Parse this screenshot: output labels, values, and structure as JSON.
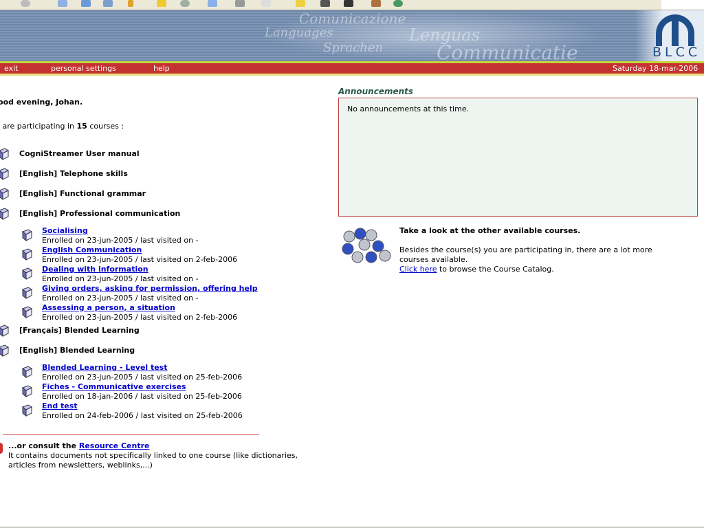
{
  "banner": {
    "watermarks": [
      "Comunicazione",
      "Lenguas",
      "Languages",
      "Sprachen",
      "Communicatie"
    ],
    "logo": "BLCC"
  },
  "nav": {
    "exit": "exit",
    "settings": "personal settings",
    "help": "help",
    "date": "Saturday 18-mar-2006"
  },
  "greeting": "Good evening, Johan.",
  "participating": {
    "pre": "You are participating in ",
    "count": "15",
    "post": " courses :"
  },
  "courses": [
    {
      "title": "CogniStreamer User manual"
    },
    {
      "title": "[English] Telephone skills"
    },
    {
      "title": "[English] Functional grammar"
    },
    {
      "title": "[English] Professional communication",
      "modules": [
        {
          "title": "Socialising",
          "info": "Enrolled on 23-jun-2005 / last visited on -"
        },
        {
          "title": "English Communication",
          "info": "Enrolled on 23-jun-2005 / last visited on 2-feb-2006"
        },
        {
          "title": "Dealing with information",
          "info": "Enrolled on 23-jun-2005 / last visited on -"
        },
        {
          "title": "Giving orders, asking for permission, offering help",
          "info": "Enrolled on 23-jun-2005 / last visited on -"
        },
        {
          "title": "Assessing a person, a situation",
          "info": "Enrolled on 23-jun-2005 / last visited on 2-feb-2006"
        }
      ]
    },
    {
      "title": "[Français] Blended Learning"
    },
    {
      "title": "[English] Blended Learning",
      "modules": [
        {
          "title": "Blended Learning - Level test",
          "info": "Enrolled on 23-jun-2005 / last visited on 25-feb-2006"
        },
        {
          "title": "Fiches - Communicative exercises",
          "info": "Enrolled on 18-jan-2006 / last visited on 25-feb-2006"
        },
        {
          "title": "End test",
          "info": "Enrolled on 24-feb-2006 / last visited on 25-feb-2006"
        }
      ]
    }
  ],
  "resource": {
    "pre": "...or consult the ",
    "link": "Resource Centre",
    "desc1": "It contains documents not specifically linked to one course (like dictionaries,",
    "desc2": "articles from newsletters, weblinks,...)"
  },
  "announcements": {
    "title": "Announcements",
    "text": "No announcements at this time."
  },
  "catalog": {
    "title": "Take a look at the other available courses.",
    "desc1": "Besides the course(s) you are participating in, there are a lot more",
    "desc2": "courses available.",
    "link": "Click here",
    "post": " to browse the Course Catalog."
  }
}
